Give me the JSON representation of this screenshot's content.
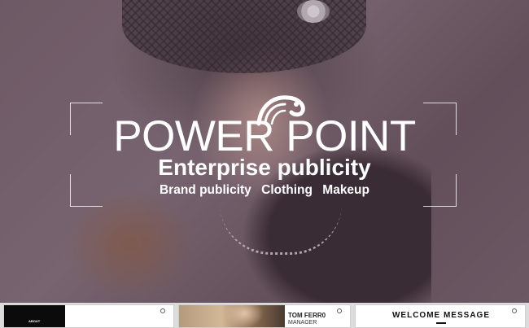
{
  "slide": {
    "title": "POWER POINT",
    "subtitle": "Enterprise publicity",
    "tags": [
      "Brand publicity",
      "Clothing",
      "Makeup"
    ]
  },
  "thumbnails": [
    {
      "dark_label": "ABOUT"
    },
    {
      "name": "TOM FERR0",
      "role": "MANAGER"
    },
    {
      "title": "WELCOME MESSAGE"
    }
  ],
  "icons": {
    "logo": "chameleon-logo-icon",
    "thumbnail_marker": "clock-icon"
  },
  "colors": {
    "title_text": "#ffffff",
    "strip_bg": "#dcdcdc"
  }
}
